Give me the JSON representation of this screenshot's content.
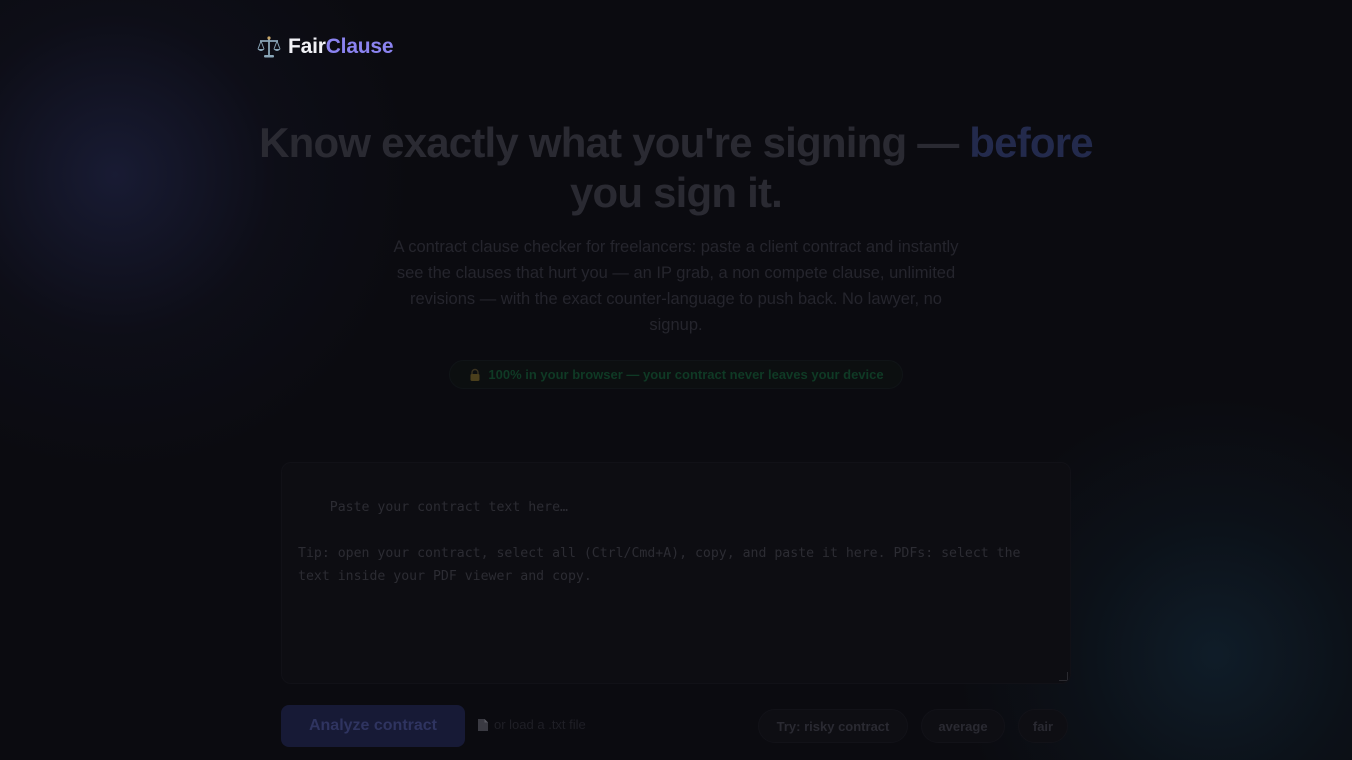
{
  "brand": {
    "icon": "scales-icon",
    "name_part1": "Fair",
    "name_part2": "Clause",
    "colors": {
      "primary": "#f1f1f6",
      "accent": "#8b83f0"
    }
  },
  "hero": {
    "title_main": "Know exactly what you're signing — ",
    "title_accent": "before",
    "title_end": " you sign it.",
    "subtitle": "A contract clause checker for freelancers: paste a client contract and instantly see the clauses that hurt you — an IP grab, a non compete clause, unlimited revisions — with the exact counter-language to push back. No lawyer, no signup.",
    "privacy_icon": "lock-icon",
    "privacy_text": "100% in your browser — your contract never leaves your device"
  },
  "editor": {
    "placeholder": "Paste your contract text here…\n\nTip: open your contract, select all (Ctrl/Cmd+A), copy, and paste it here. PDFs: select the text inside your PDF viewer and copy."
  },
  "actions": {
    "analyze_label": "Analyze contract",
    "file_icon": "file-icon",
    "load_file_label": "or load a .txt file",
    "sample_risky_label": "Try: risky contract",
    "sample_average_label": "average",
    "sample_fair_label": "fair"
  }
}
